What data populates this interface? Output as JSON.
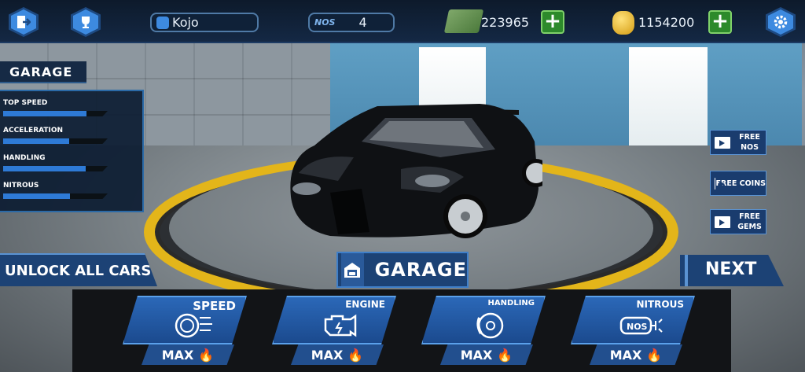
{
  "header": {
    "player_name": "Kojo",
    "nos_label": "NOS",
    "nos_value": "4",
    "cash_value": "223965",
    "coins_value": "1154200"
  },
  "garage_panel": {
    "title": "GARAGE",
    "stats": [
      {
        "label": "TOP SPEED",
        "level": 0.8
      },
      {
        "label": "ACCELERATION",
        "level": 0.63
      },
      {
        "label": "HANDLING",
        "level": 0.79
      },
      {
        "label": "NITROUS",
        "level": 0.64
      }
    ]
  },
  "side_buttons": {
    "free_nos": [
      "FREE",
      "NOS"
    ],
    "free_coins": "FREE COINS",
    "free_gems": [
      "FREE",
      "GEMS"
    ]
  },
  "unlock_all_cars": "UNLOCK ALL CARS",
  "garage_button": "GARAGE",
  "next_button": "NEXT",
  "upgrades": [
    {
      "name": "SPEED",
      "status": "MAX"
    },
    {
      "name": "ENGINE",
      "status": "MAX"
    },
    {
      "name": "HANDLING",
      "status": "MAX"
    },
    {
      "name": "NITROUS",
      "status": "MAX"
    }
  ],
  "upgrade_icons": [
    "speedometer-icon",
    "engine-icon",
    "brake-disc-icon",
    "nos-bottle-icon"
  ],
  "colors": {
    "accent": "#2e7ad6",
    "platform_ring": "#e3b51a",
    "plus": "#2d8a2b"
  }
}
